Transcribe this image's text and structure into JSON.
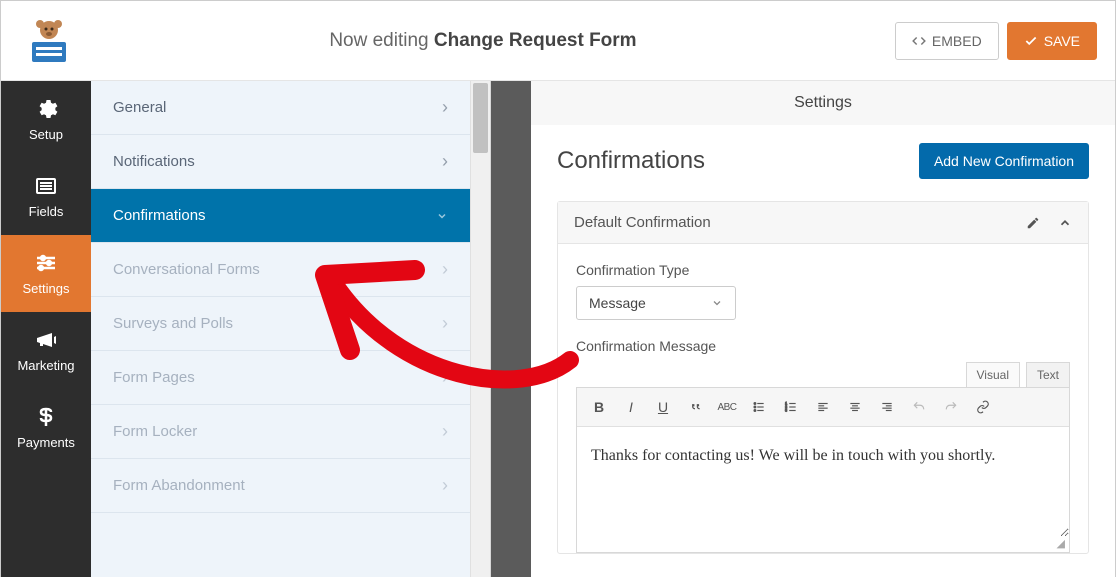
{
  "topbar": {
    "now_editing": "Now editing",
    "form_name": "Change Request Form",
    "embed": "EMBED",
    "save": "SAVE"
  },
  "iconnav": {
    "items": [
      {
        "label": "Setup"
      },
      {
        "label": "Fields"
      },
      {
        "label": "Settings"
      },
      {
        "label": "Marketing"
      },
      {
        "label": "Payments"
      }
    ]
  },
  "subpanel": {
    "items": [
      {
        "label": "General",
        "state": "normal"
      },
      {
        "label": "Notifications",
        "state": "normal"
      },
      {
        "label": "Confirmations",
        "state": "selected"
      },
      {
        "label": "Conversational Forms",
        "state": "disabled"
      },
      {
        "label": "Surveys and Polls",
        "state": "disabled"
      },
      {
        "label": "Form Pages",
        "state": "disabled"
      },
      {
        "label": "Form Locker",
        "state": "disabled"
      },
      {
        "label": "Form Abandonment",
        "state": "disabled"
      }
    ]
  },
  "content": {
    "header": "Settings",
    "section_title": "Confirmations",
    "add_button": "Add New Confirmation",
    "panel_title": "Default Confirmation",
    "confirmation_type_label": "Confirmation Type",
    "confirmation_type_value": "Message",
    "confirmation_message_label": "Confirmation Message",
    "editor_tabs": {
      "visual": "Visual",
      "text": "Text"
    },
    "editor_content": "Thanks for contacting us! We will be in touch with you shortly."
  }
}
